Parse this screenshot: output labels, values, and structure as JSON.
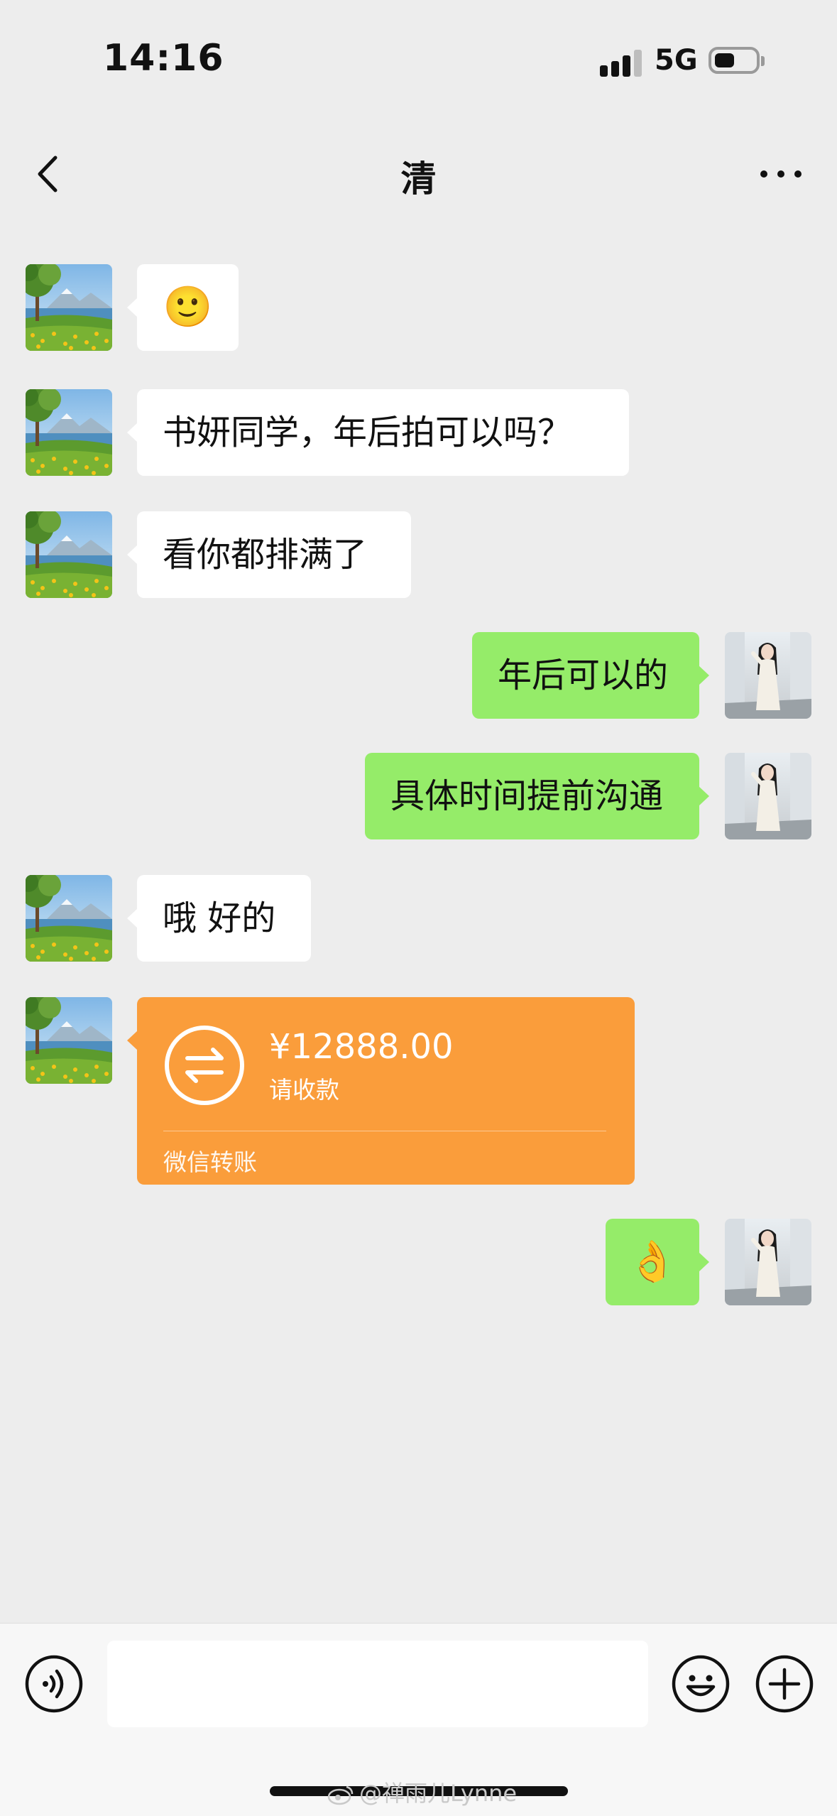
{
  "status_bar": {
    "time": "14:16",
    "network": "5G",
    "signal_icon": "cellular-signal-icon",
    "battery_icon": "battery-icon",
    "battery_level": 0.5
  },
  "header": {
    "title": "清",
    "back_icon": "chevron-left-icon",
    "more_icon": "more-dots-icon"
  },
  "messages": [
    {
      "direction": "incoming",
      "type": "emoji",
      "text": "🙂"
    },
    {
      "direction": "incoming",
      "type": "text",
      "text": "书妍同学，年后拍可以吗？"
    },
    {
      "direction": "incoming",
      "type": "text",
      "text": "看你都排满了"
    },
    {
      "direction": "outgoing",
      "type": "text",
      "text": "年后可以的"
    },
    {
      "direction": "outgoing",
      "type": "text",
      "text": "具体时间提前沟通"
    },
    {
      "direction": "incoming",
      "type": "text",
      "text": "哦 好的"
    },
    {
      "direction": "incoming",
      "type": "transfer",
      "amount": "¥12888.00",
      "description": "请收款",
      "label": "微信转账"
    },
    {
      "direction": "outgoing",
      "type": "emoji",
      "text": "👌"
    }
  ],
  "input_bar": {
    "voice_icon": "voice-icon",
    "input_value": "",
    "emoji_icon": "smiley-icon",
    "plus_icon": "plus-circle-icon"
  },
  "watermark": "@禅雨儿Lynne",
  "colors": {
    "background": "#ededed",
    "outgoing_bubble": "#95ec69",
    "incoming_bubble": "#ffffff",
    "transfer_card": "#fa9d3b"
  }
}
